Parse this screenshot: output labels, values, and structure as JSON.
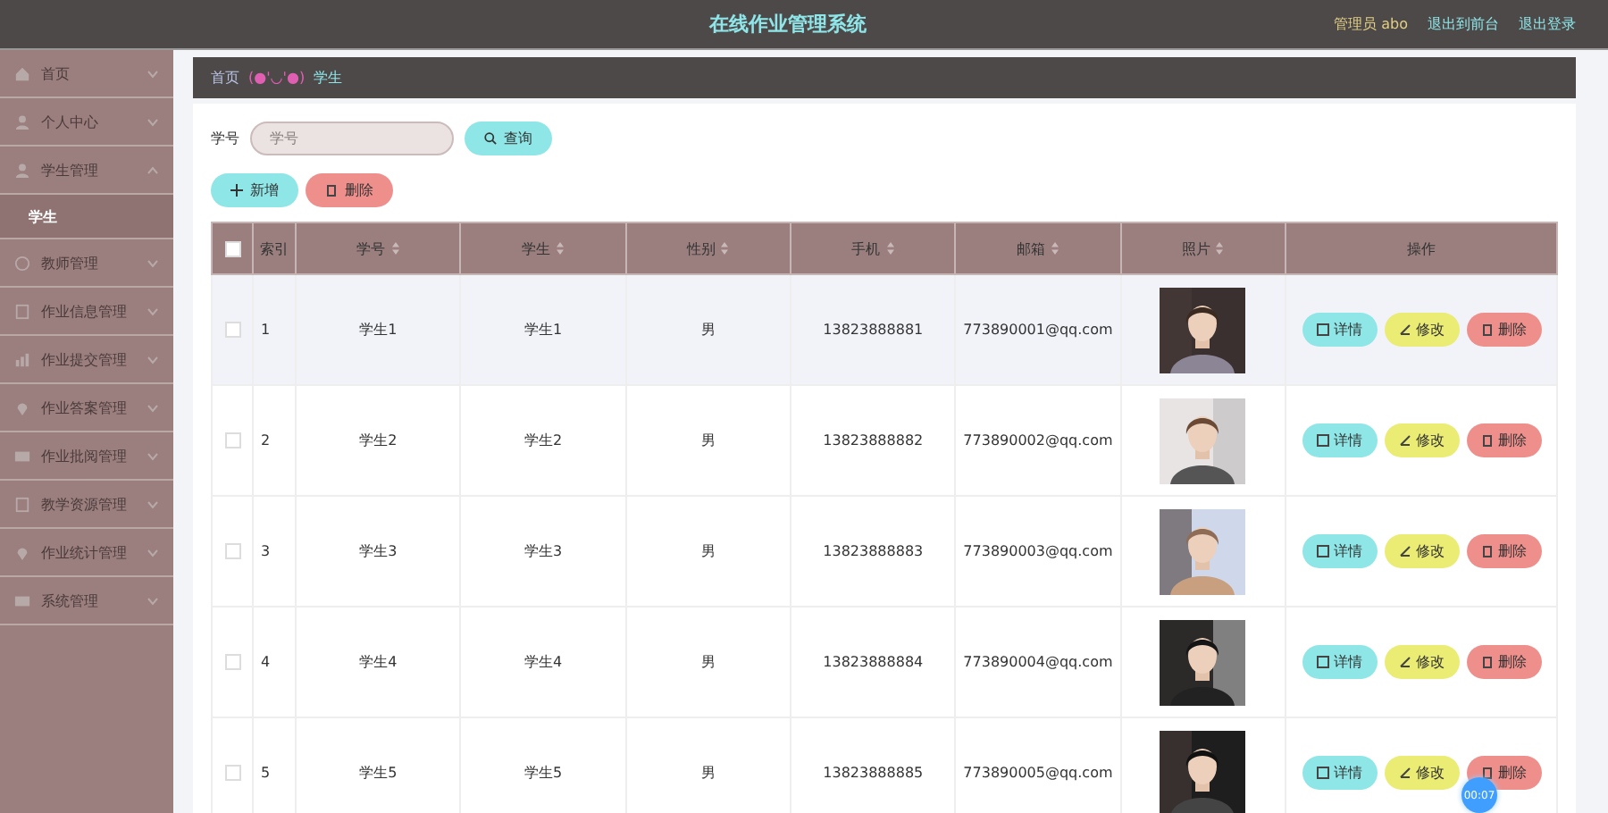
{
  "header": {
    "title": "在线作业管理系统",
    "user": "管理员 abo",
    "links": [
      "退出到前台",
      "退出登录"
    ]
  },
  "sidebar": {
    "items": [
      {
        "label": "首页",
        "expanded": false
      },
      {
        "label": "个人中心",
        "expanded": false
      },
      {
        "label": "学生管理",
        "expanded": true,
        "children": [
          {
            "label": "学生",
            "selected": true
          }
        ]
      },
      {
        "label": "教师管理",
        "expanded": false
      },
      {
        "label": "作业信息管理",
        "expanded": false
      },
      {
        "label": "作业提交管理",
        "expanded": false
      },
      {
        "label": "作业答案管理",
        "expanded": false
      },
      {
        "label": "作业批阅管理",
        "expanded": false
      },
      {
        "label": "教学资源管理",
        "expanded": false
      },
      {
        "label": "作业统计管理",
        "expanded": false
      },
      {
        "label": "系统管理",
        "expanded": false
      }
    ]
  },
  "breadcrumb": {
    "home": "首页",
    "separator": "(●'◡'●)",
    "current": "学生"
  },
  "search": {
    "label": "学号",
    "placeholder": "学号",
    "button": "查询"
  },
  "actions": [
    "新增",
    "删除"
  ],
  "table": {
    "select_all": {
      "checked": false
    },
    "columns": [
      {
        "label": "索引",
        "sortable": false
      },
      {
        "label": "学号",
        "sortable": true
      },
      {
        "label": "学生",
        "sortable": true
      },
      {
        "label": "性别",
        "sortable": true
      },
      {
        "label": "手机",
        "sortable": true
      },
      {
        "label": "邮箱",
        "sortable": true
      },
      {
        "label": "照片",
        "sortable": true
      },
      {
        "label": "操作",
        "sortable": false
      }
    ],
    "rows": [
      {
        "checked": false,
        "highlighted": true,
        "cells": [
          "1",
          "学生1",
          "学生1",
          "男",
          "13823888881",
          "773890001@qq.com"
        ],
        "buttons": [
          "详情",
          "修改",
          "删除"
        ]
      },
      {
        "checked": false,
        "highlighted": false,
        "cells": [
          "2",
          "学生2",
          "学生2",
          "男",
          "13823888882",
          "773890002@qq.com"
        ],
        "buttons": [
          "详情",
          "修改",
          "删除"
        ]
      },
      {
        "checked": false,
        "highlighted": false,
        "cells": [
          "3",
          "学生3",
          "学生3",
          "男",
          "13823888883",
          "773890003@qq.com"
        ],
        "buttons": [
          "详情",
          "修改",
          "删除"
        ]
      },
      {
        "checked": false,
        "highlighted": false,
        "cells": [
          "4",
          "学生4",
          "学生4",
          "男",
          "13823888884",
          "773890004@qq.com"
        ],
        "buttons": [
          "详情",
          "修改",
          "删除"
        ]
      },
      {
        "checked": false,
        "highlighted": false,
        "cells": [
          "5",
          "学生5",
          "学生5",
          "男",
          "13823888885",
          "773890005@qq.com"
        ],
        "buttons": [
          "详情",
          "修改",
          "删除"
        ]
      }
    ]
  },
  "badge": "00:07"
}
